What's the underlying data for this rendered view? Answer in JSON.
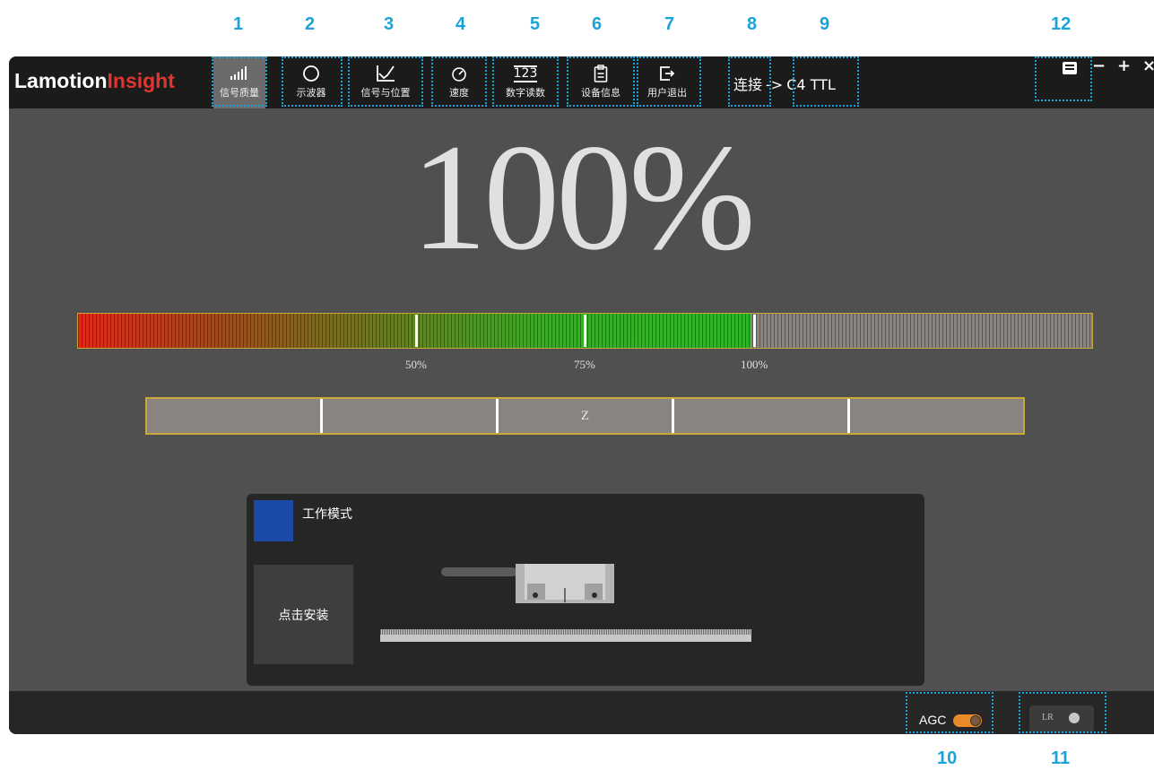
{
  "callouts": [
    "1",
    "2",
    "3",
    "4",
    "5",
    "6",
    "7",
    "8",
    "9",
    "10",
    "11",
    "12"
  ],
  "app": {
    "logo_main": "Lamotion",
    "logo_accent": "Insight",
    "toolbar": [
      {
        "id": "signal-quality",
        "label": "信号质量",
        "icon": "signal-bars-icon",
        "active": true
      },
      {
        "id": "oscilloscope",
        "label": "示波器",
        "icon": "circle-icon",
        "active": false
      },
      {
        "id": "signal-position",
        "label": "信号与位置",
        "icon": "line-chart-icon",
        "active": false
      },
      {
        "id": "speed",
        "label": "速度",
        "icon": "gauge-icon",
        "active": false
      },
      {
        "id": "digital-reading",
        "label": "数字读数",
        "icon": "number-icon",
        "active": false
      },
      {
        "id": "device-info",
        "label": "设备信息",
        "icon": "clipboard-icon",
        "active": false
      },
      {
        "id": "user-logout",
        "label": "用户退出",
        "icon": "logout-icon",
        "active": false
      }
    ],
    "number_icon_text": "123",
    "connection": {
      "prefix": "连接",
      "arrow": "->",
      "device": "C4 TTL"
    },
    "window_controls": {
      "minimize": "−",
      "maximize": "+",
      "close": "×"
    }
  },
  "signal": {
    "percent_text": "100%",
    "quality_fraction": 0.663,
    "marks": [
      "50%",
      "75%",
      "100%"
    ],
    "z_label": "Z"
  },
  "panel": {
    "mode_label": "工作模式",
    "mode_color": "#1b4aa8",
    "install_label": "点击安装"
  },
  "status": {
    "agc_label": "AGC",
    "agc_on": true,
    "lr_label": "LR",
    "lr_on": false
  },
  "colors": {
    "accent": "#1aa3d9",
    "bar_border": "#c9a83a",
    "logo_red": "#e0362f"
  }
}
